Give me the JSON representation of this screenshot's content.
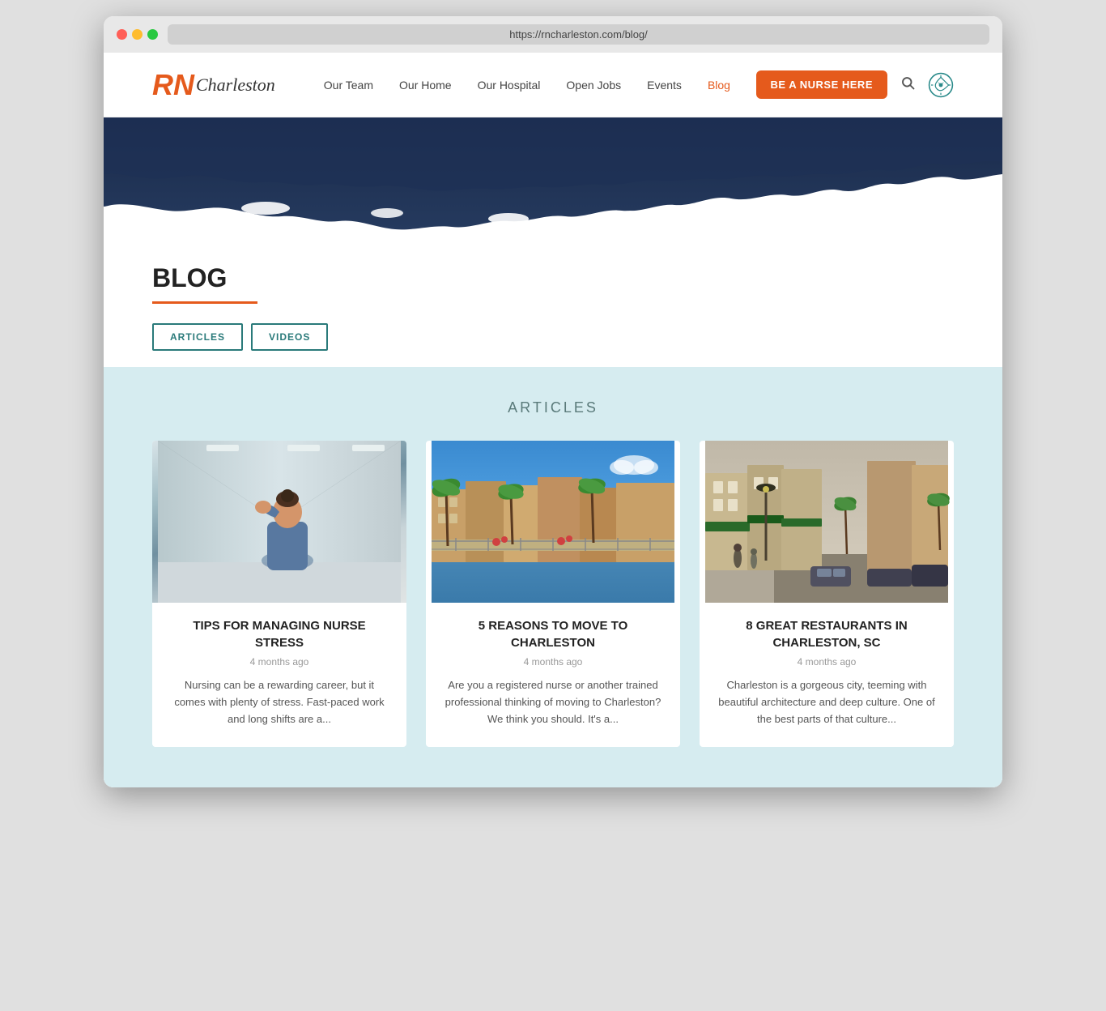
{
  "browser": {
    "url": "https://rncharleston.com/blog/"
  },
  "header": {
    "logo_rn": "RN",
    "logo_charleston": "Charleston",
    "nav": {
      "items": [
        {
          "label": "Our Team",
          "active": false
        },
        {
          "label": "Our Home",
          "active": false
        },
        {
          "label": "Our Hospital",
          "active": false
        },
        {
          "label": "Open Jobs",
          "active": false
        },
        {
          "label": "Events",
          "active": false
        },
        {
          "label": "Blog",
          "active": true
        }
      ],
      "cta_label": "BE A NURSE HERE"
    }
  },
  "blog": {
    "title": "BLOG",
    "filter_articles": "ARTICLES",
    "filter_videos": "VIDEOS"
  },
  "articles_section": {
    "section_title": "ARTICLES",
    "articles": [
      {
        "title": "TIPS FOR MANAGING NURSE STRESS",
        "date": "4 months ago",
        "excerpt": "Nursing can be a rewarding career, but it comes with plenty of stress. Fast-paced work and long shifts are a...",
        "img_type": "nurse"
      },
      {
        "title": "5 REASONS TO MOVE TO CHARLESTON",
        "date": "4 months ago",
        "excerpt": "Are you a registered nurse or another trained professional thinking of moving to Charleston? We think you should. It's a...",
        "img_type": "waterfront"
      },
      {
        "title": "8 GREAT RESTAURANTS IN CHARLESTON, SC",
        "date": "4 months ago",
        "excerpt": "Charleston is a gorgeous city, teeming with beautiful architecture and deep culture. One of the best parts of that culture...",
        "img_type": "street"
      }
    ]
  },
  "colors": {
    "accent": "#e55a1c",
    "teal": "#2a7a7a",
    "navy": "#1a2a4a",
    "light_bg": "#d6ecf0"
  }
}
